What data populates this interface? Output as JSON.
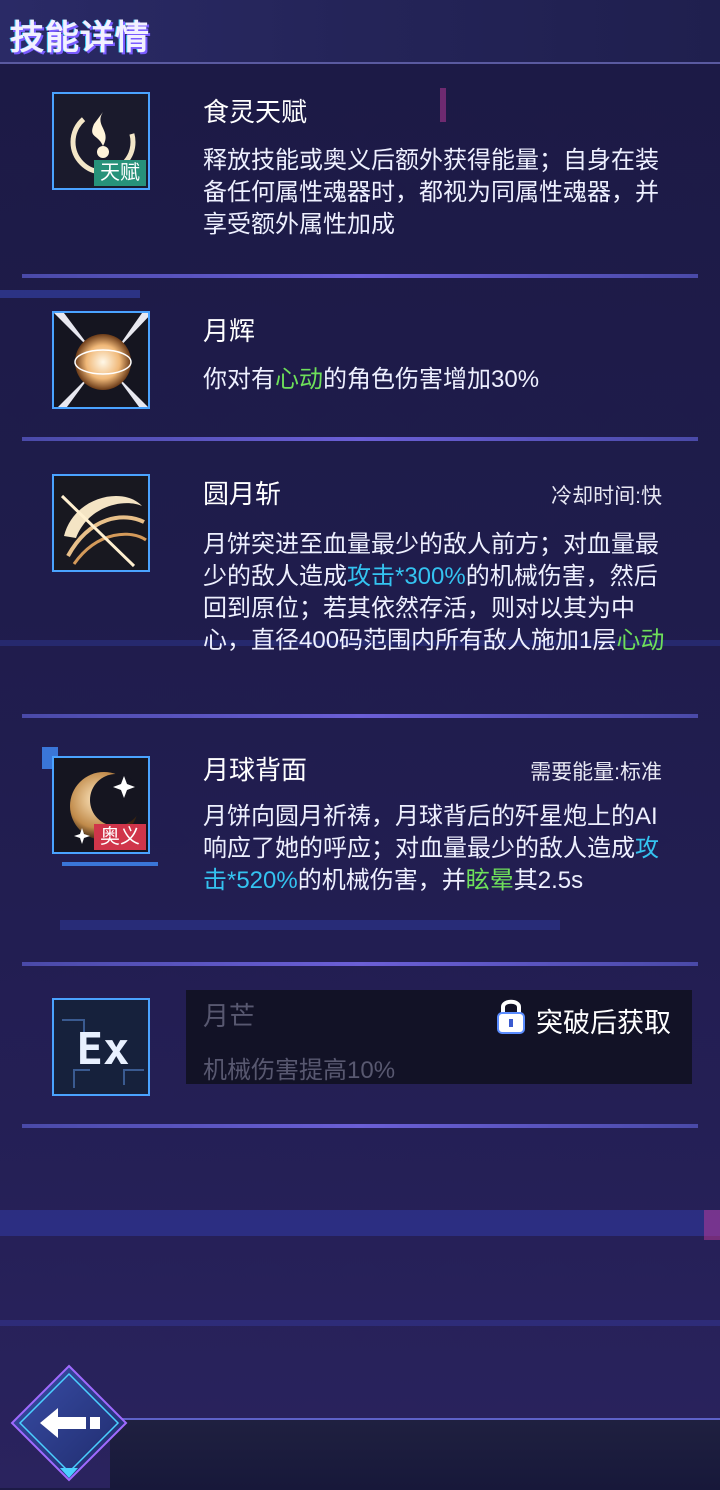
{
  "header": {
    "title": "技能详情"
  },
  "skills": [
    {
      "name": "食灵天赋",
      "badge": "天赋",
      "icon": "flame-spirit-icon",
      "desc": "释放技能或奥义后额外获得能量；自身在装备任何属性魂器时，都视为同属性魂器，并享受额外属性加成"
    },
    {
      "name": "月辉",
      "icon": "moon-radiance-icon",
      "desc_parts": [
        "你对有",
        "心动",
        "的角色伤害增加30%"
      ]
    },
    {
      "name": "圆月斩",
      "meta": "冷却时间:快",
      "icon": "crescent-slash-icon",
      "desc_parts": [
        "月饼突进至血量最少的敌人前方；对血量最少的敌人造成",
        "攻击*300%",
        "的机械伤害，然后回到原位；若其依然存活，则对以其为中心，直径400码范围内所有敌人施加1层",
        "心动"
      ]
    },
    {
      "name": "月球背面",
      "meta": "需要能量:标准",
      "badge": "奥义",
      "icon": "moon-back-icon",
      "desc_parts": [
        "月饼向圆月祈祷，月球背后的歼星炮上的AI响应了她的呼应；对血量最少的敌人造成",
        "攻击*520%",
        "的机械伤害，并",
        "眩晕",
        "其2.5s"
      ]
    },
    {
      "name": "月芒",
      "icon": "ex-icon",
      "icon_text": "Ex",
      "desc": "机械伤害提高10%",
      "lock_label": "突破后获取"
    }
  ],
  "colors": {
    "highlight_green": "#6ee05a",
    "highlight_cyan": "#34c3f0",
    "talent_badge": "#27927a",
    "ult_badge": "#d0354a",
    "icon_border": "#4aa3ff"
  },
  "footer": {
    "back_icon": "back-arrow-icon"
  }
}
